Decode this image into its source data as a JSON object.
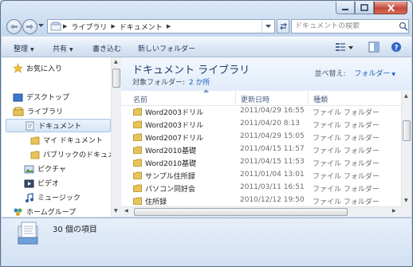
{
  "window": {
    "caption": {
      "minimize": "minimize-icon",
      "maximize": "maximize-icon",
      "close": "close-icon"
    }
  },
  "address": {
    "crumbs": [
      "ライブラリ",
      "ドキュメント"
    ],
    "search_placeholder": "ドキュメントの検索"
  },
  "toolbar": {
    "organize": "整理",
    "share": "共有",
    "burn": "書き込む",
    "new_folder": "新しいフォルダー"
  },
  "nav": {
    "favorites": "お気に入り",
    "desktop": "デスクトップ",
    "libraries": "ライブラリ",
    "documents": "ドキュメント",
    "my_documents": "マイ ドキュメント",
    "public_documents": "パブリックのドキュメント",
    "pictures": "ピクチャ",
    "videos": "ビデオ",
    "music": "ミュージック",
    "homegroup": "ホームグループ"
  },
  "library": {
    "title": "ドキュメント ライブラリ",
    "subtitle_label": "対象フォルダー:",
    "subtitle_link": "2 か所",
    "arrange_label": "並べ替え:",
    "arrange_value": "フォルダー"
  },
  "columns": {
    "name": "名前",
    "date": "更新日時",
    "type": "種類"
  },
  "files": [
    {
      "name": "Word2003ドリル",
      "date": "2011/04/29 16:55",
      "type": "ファイル フォルダー"
    },
    {
      "name": "Word2003ドリル",
      "date": "2011/04/20 8:13",
      "type": "ファイル フォルダー"
    },
    {
      "name": "Word2007ドリル",
      "date": "2011/04/29 15:05",
      "type": "ファイル フォルダー"
    },
    {
      "name": "Word2010基礎",
      "date": "2011/04/15 11:57",
      "type": "ファイル フォルダー"
    },
    {
      "name": "Word2010基礎",
      "date": "2011/04/15 11:53",
      "type": "ファイル フォルダー"
    },
    {
      "name": "サンプル住所録",
      "date": "2011/01/04 13:01",
      "type": "ファイル フォルダー"
    },
    {
      "name": "パソコン同好会",
      "date": "2011/03/11 16:51",
      "type": "ファイル フォルダー"
    },
    {
      "name": "住所録",
      "date": "2010/12/12 19:50",
      "type": "ファイル フォルダー"
    }
  ],
  "status": {
    "count": "30 個の項目"
  },
  "colors": {
    "link": "#1a5ebd",
    "title": "#1e3a66",
    "folder": "#e8c35a"
  }
}
